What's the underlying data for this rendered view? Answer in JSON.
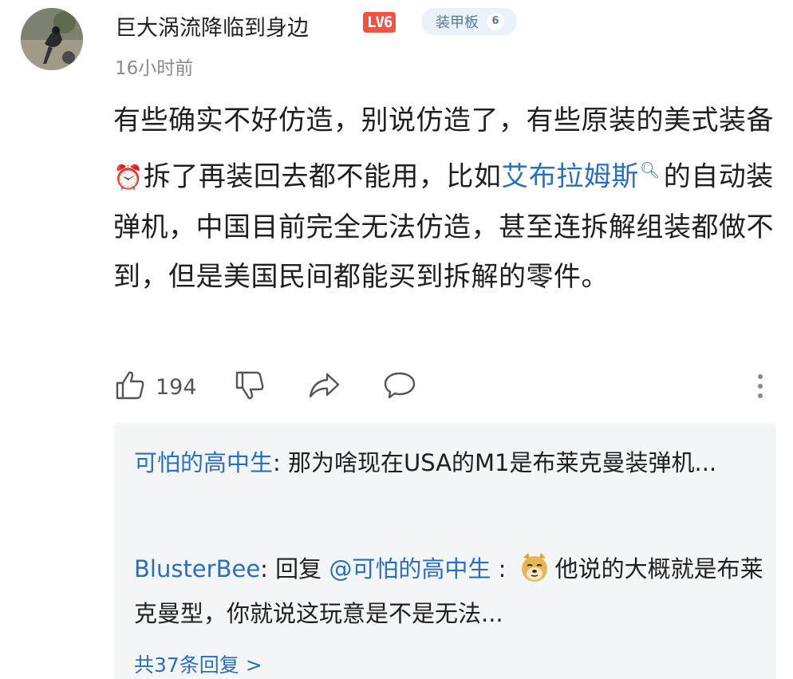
{
  "user": {
    "name": "巨大涡流降临到身边",
    "level": "LV6",
    "tag": {
      "label": "装甲板",
      "count": "6"
    },
    "time": "16小时前"
  },
  "comment": {
    "text_1": "有些确实不好仿造，别说仿造了，有些原装的美式装备",
    "emoji": "⏰",
    "text_2": "拆了再装回去都不能用，比如",
    "link": "艾布拉姆斯",
    "search_icon": "magnifier-icon",
    "text_3": "的自动装弹机，中国目前完全无法仿造，甚至连拆解组装都做不到，但是美国民间都能买到拆解的零件。"
  },
  "actions": {
    "like_count": "194",
    "icons": [
      "thumbs-up-icon",
      "thumbs-down-icon",
      "share-icon",
      "comment-icon",
      "more-icon"
    ]
  },
  "replies": [
    {
      "author": "可怕的高中生",
      "separator": ": ",
      "text": "那为啥现在USA的M1是布莱克曼装弹机..."
    },
    {
      "author": "BlusterBee",
      "separator": ": ",
      "reply_prefix": "回复 ",
      "mention": "@可怕的高中生",
      "mention_sep": " : ",
      "emoji_icon": "doge-icon",
      "text": "他说的大概就是布莱克曼型，你就说这玩意是不是无法..."
    }
  ],
  "more_replies": "共37条回复 >",
  "colors": {
    "link": "#2d6fb4",
    "level_badge": "#ec5546",
    "reply_bg": "#f4f5f7"
  }
}
